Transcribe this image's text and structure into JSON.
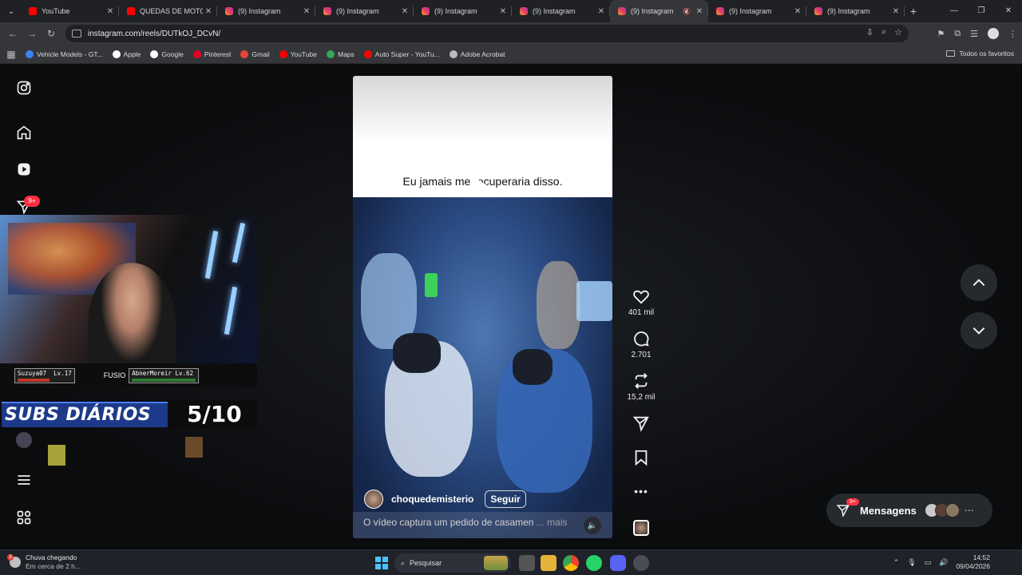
{
  "browser": {
    "tabs": [
      {
        "title": "YouTube",
        "icon": "youtube",
        "active": false
      },
      {
        "title": "QUEDAS DE MOTO (E",
        "icon": "youtube",
        "active": false
      },
      {
        "title": "(9) Instagram",
        "icon": "instagram",
        "active": false
      },
      {
        "title": "(9) Instagram",
        "icon": "instagram",
        "active": false
      },
      {
        "title": "(9) Instagram",
        "icon": "instagram",
        "active": false
      },
      {
        "title": "(9) Instagram",
        "icon": "instagram",
        "active": false
      },
      {
        "title": "(9) Instagram",
        "icon": "instagram",
        "active": true
      },
      {
        "title": "(9) Instagram",
        "icon": "instagram",
        "active": false
      },
      {
        "title": "(9) Instagram",
        "icon": "instagram",
        "active": false
      }
    ],
    "new_tab": "+",
    "url": "instagram.com/reels/DUTkOJ_DCvN/",
    "bookmarks": [
      {
        "label": "Vehicle Models - GT...",
        "color": "#3b82f6"
      },
      {
        "label": "Apple",
        "color": "#ffffff"
      },
      {
        "label": "Google",
        "color": "#ffffff"
      },
      {
        "label": "Pinterest",
        "color": "#e60023"
      },
      {
        "label": "Gmail",
        "color": "#ea4335"
      },
      {
        "label": "YouTube",
        "color": "#ff0000"
      },
      {
        "label": "Maps",
        "color": "#34a853"
      },
      {
        "label": "Auto Super - YouTu...",
        "color": "#ff0000"
      },
      {
        "label": "Adobe Acrobat",
        "color": "#bbbbbb"
      }
    ],
    "all_favorites": "Todos os favoritos"
  },
  "instagram": {
    "notifications_badge": "9+",
    "reel": {
      "top_caption": "Eu jamais me recuperaria disso.",
      "username": "choquedemisterio",
      "follow_label": "Seguir",
      "description": "O vídeo captura um pedido de casamen",
      "more": "... mais"
    },
    "actions": {
      "likes": "401 mil",
      "comments": "2.701",
      "reposts": "15,2 mil"
    },
    "messages": {
      "label": "Mensagens",
      "badge": "9+"
    }
  },
  "stream_overlay": {
    "player1": {
      "name": "Suzuya07",
      "level": "Lv.17"
    },
    "player2": {
      "name": "AbnerMoreir",
      "level": "Lv.62"
    },
    "fusion_text": "FUSIO",
    "subs_label": "SUBS DIÁRIOS",
    "subs_count": "5/10"
  },
  "taskbar": {
    "weather_title": "Chuva chegando",
    "weather_sub": "Em cerca de 2 h...",
    "weather_badge": "3",
    "search_placeholder": "Pesquisar",
    "time": "14:52",
    "date": "09/04/2026"
  },
  "colors": {
    "accent": "#ff3040",
    "page_bg": "#0b0c0e",
    "chrome_bg": "#35363a"
  }
}
